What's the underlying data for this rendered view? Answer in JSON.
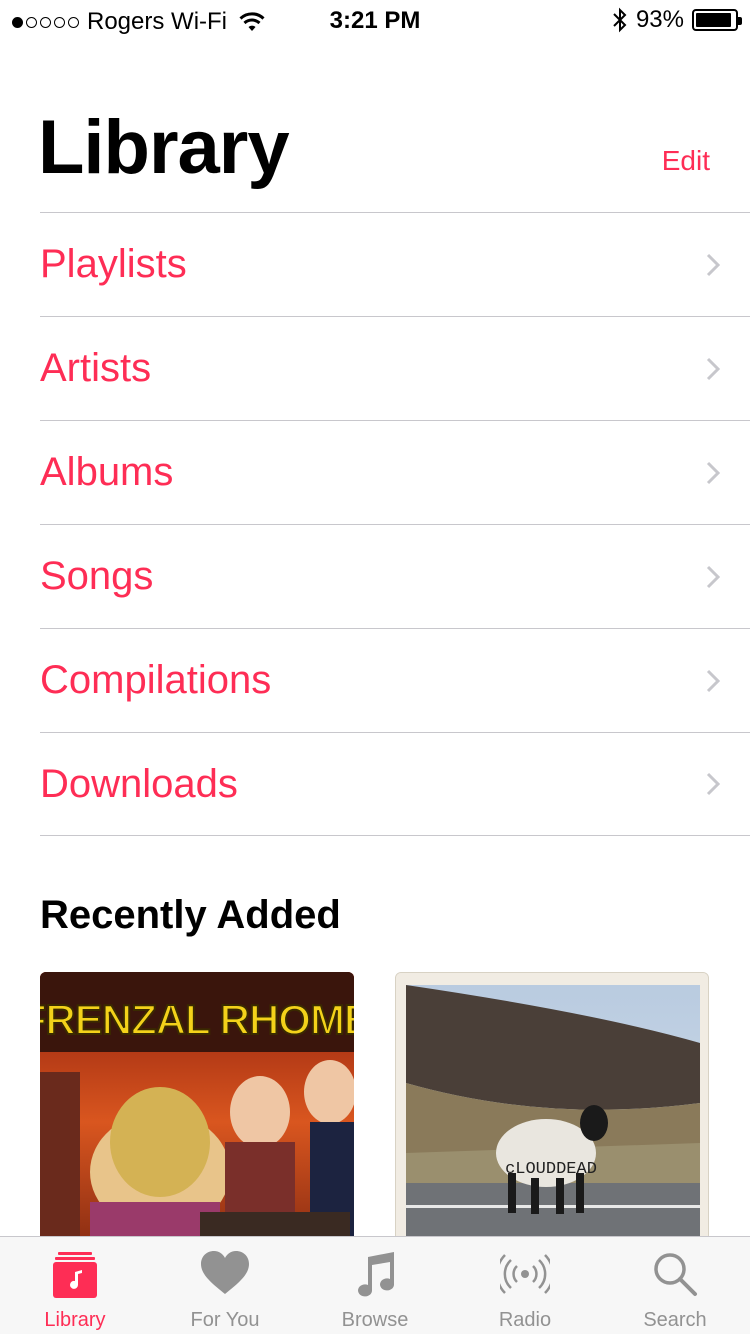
{
  "status_bar": {
    "carrier": "Rogers Wi-Fi",
    "time": "3:21 PM",
    "battery": "93%",
    "battery_level": 0.93
  },
  "header": {
    "title": "Library",
    "edit_label": "Edit"
  },
  "menu": {
    "items": [
      {
        "label": "Playlists"
      },
      {
        "label": "Artists"
      },
      {
        "label": "Albums"
      },
      {
        "label": "Songs"
      },
      {
        "label": "Compilations"
      },
      {
        "label": "Downloads"
      }
    ]
  },
  "recently_added": {
    "title": "Recently Added",
    "albums": [
      {
        "art_text": "FRENZAL RHOMB"
      },
      {
        "art_text": "cLOUDDEAD"
      }
    ]
  },
  "tab_bar": {
    "tabs": [
      {
        "label": "Library",
        "icon": "library-icon",
        "active": true
      },
      {
        "label": "For You",
        "icon": "heart-icon",
        "active": false
      },
      {
        "label": "Browse",
        "icon": "music-note-icon",
        "active": false
      },
      {
        "label": "Radio",
        "icon": "radio-icon",
        "active": false
      },
      {
        "label": "Search",
        "icon": "search-icon",
        "active": false
      }
    ]
  },
  "colors": {
    "accent": "#fe2d55",
    "inactive": "#929292",
    "separator": "#c8c7cc"
  }
}
